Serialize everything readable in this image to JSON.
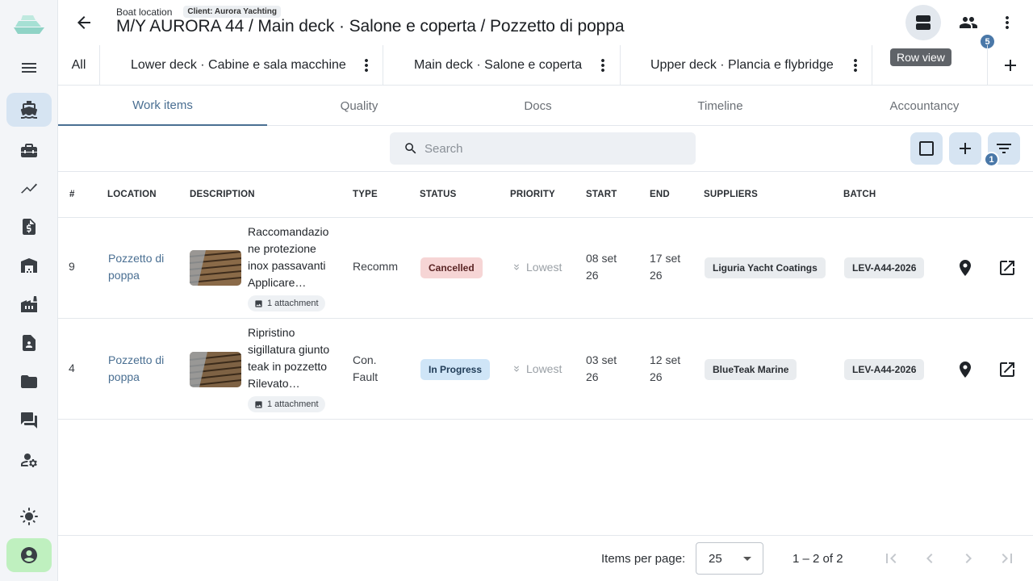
{
  "header": {
    "section_label": "Boat location",
    "client_label": "Client: Aurora Yachting",
    "title": "M/Y AURORA 44 / Main deck · Salone e coperta / Pozzetto di poppa",
    "users_badge": "5",
    "tooltip": "Row view"
  },
  "decks": {
    "all": "All",
    "items": [
      {
        "label": "Lower deck · Cabine e sala macchine"
      },
      {
        "label": "Main deck · Salone e coperta"
      },
      {
        "label": "Upper deck · Plancia e flybridge"
      }
    ]
  },
  "tabs": [
    "Work items",
    "Quality",
    "Docs",
    "Timeline",
    "Accountancy"
  ],
  "active_tab": "Work items",
  "toolbar": {
    "search_placeholder": "Search",
    "filter_badge": "1"
  },
  "table": {
    "columns": [
      "#",
      "LOCATION",
      "DESCRIPTION",
      "TYPE",
      "STATUS",
      "PRIORITY",
      "START",
      "END",
      "SUPPLIERS",
      "BATCH"
    ],
    "rows": [
      {
        "num": "9",
        "location_l1": "Pozzetto di",
        "location_l2": "poppa",
        "desc": [
          "Raccomandazio",
          "ne protezione",
          "inox passavanti",
          "Applicare…"
        ],
        "attachment": "1 attachment",
        "type_l1": "Recomm",
        "type_l2": "",
        "status": "Cancelled",
        "priority": "Lowest",
        "start_l1": "08 set",
        "start_l2": "26",
        "end_l1": "17 set",
        "end_l2": "26",
        "supplier": "Liguria Yacht Coatings",
        "batch": "LEV-A44-2026"
      },
      {
        "num": "4",
        "location_l1": "Pozzetto di",
        "location_l2": "poppa",
        "desc": [
          "Ripristino",
          "sigillatura giunto",
          "teak in pozzetto",
          "Rilevato…"
        ],
        "attachment": "1 attachment",
        "type_l1": "Con.",
        "type_l2": "Fault",
        "status": "In Progress",
        "priority": "Lowest",
        "start_l1": "03 set",
        "start_l2": "26",
        "end_l1": "12 set",
        "end_l2": "26",
        "supplier": "BlueTeak Marine",
        "batch": "LEV-A44-2026"
      }
    ]
  },
  "pager": {
    "items_per_page_label": "Items per page:",
    "page_size": "25",
    "range": "1 – 2 of 2"
  },
  "colors": {
    "accent": "#4a6f92",
    "rail_active": "#d6e4f2",
    "account_bg": "#bff0bf",
    "cancelled_bg": "#f6d5d5",
    "in_progress_bg": "#cfe5f7"
  },
  "icons": {
    "rail": [
      "boat-logo-icon",
      "menu-icon",
      "boat-icon",
      "toolbox-icon",
      "trending-icon",
      "invoice-icon",
      "warehouse-icon",
      "factory-icon",
      "contact-icon",
      "folder-icon",
      "chat-icon",
      "user-settings-icon",
      "theme-icon",
      "account-icon"
    ]
  }
}
